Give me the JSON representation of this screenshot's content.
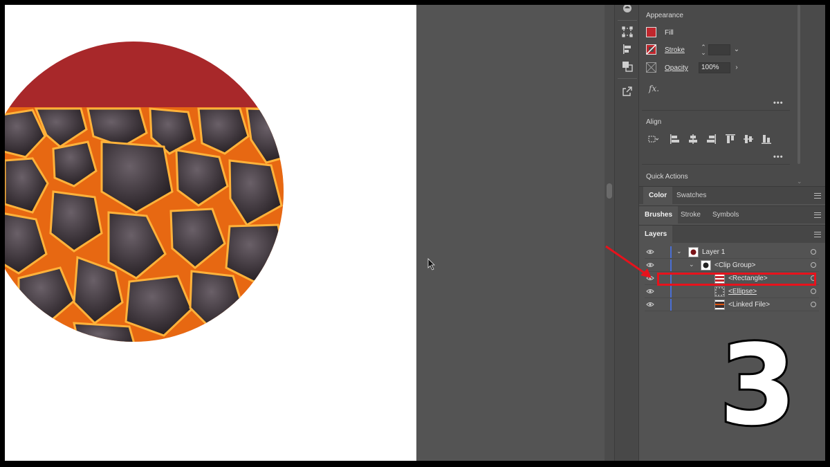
{
  "properties": {
    "appearance_title": "Appearance",
    "fill_label": "Fill",
    "stroke_label": "Stroke",
    "opacity_label": "Opacity",
    "opacity_value": "100%",
    "fx_label": "fx.",
    "align_title": "Align",
    "quick_actions_title": "Quick Actions",
    "fill_color": "#c0272d"
  },
  "tabs": {
    "group1": [
      "Color",
      "Swatches"
    ],
    "group2": [
      "Brushes",
      "Stroke",
      "Symbols"
    ],
    "group3": [
      "Layers"
    ]
  },
  "layers": [
    {
      "name": "Layer 1"
    },
    {
      "name": "<Clip Group>"
    },
    {
      "name": "<Rectangle>",
      "selected_highlight": true
    },
    {
      "name": "<Ellipse>"
    },
    {
      "name": "<Linked File>"
    }
  ],
  "overlay": {
    "step_number": "3",
    "highlight_color": "#e8121c"
  },
  "icons": [
    "transform-icon",
    "align-panel-icon",
    "pathfinder-icon",
    "export-icon",
    "eye-icon",
    "target-icon",
    "cursor-icon"
  ]
}
